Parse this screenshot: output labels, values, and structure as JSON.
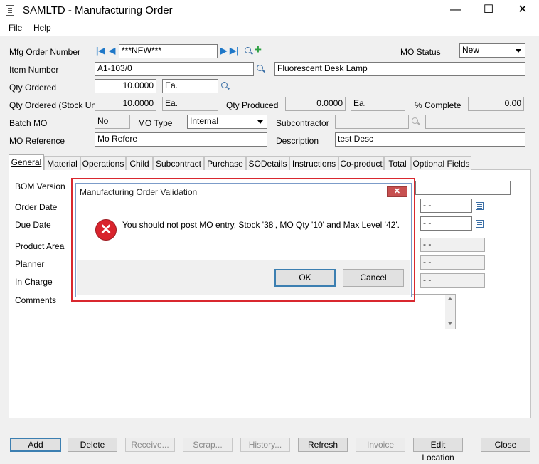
{
  "window": {
    "title": "SAMLTD - Manufacturing Order",
    "minimize": "—",
    "maximize": "☐",
    "close": "✕"
  },
  "menu": {
    "file": "File",
    "help": "Help"
  },
  "header": {
    "mfg_order_label": "Mfg Order Number",
    "mfg_order_value": "***NEW***",
    "mo_status_label": "MO Status",
    "mo_status_value": "New",
    "item_number_label": "Item Number",
    "item_number_value": "A1-103/0",
    "item_description": "Fluorescent Desk Lamp",
    "qty_ordered_label": "Qty Ordered",
    "qty_ordered_value": "10.0000",
    "qty_ordered_unit": "Ea.",
    "qty_ordered_stock_label": "Qty Ordered (Stock Unit)",
    "qty_ordered_stock_value": "10.0000",
    "qty_ordered_stock_unit": "Ea.",
    "qty_produced_label": "Qty Produced",
    "qty_produced_value": "0.0000",
    "qty_produced_unit": "Ea.",
    "pct_complete_label": "% Complete",
    "pct_complete_value": "0.00",
    "batch_mo_label": "Batch MO",
    "batch_mo_value": "No",
    "mo_type_label": "MO Type",
    "mo_type_value": "Internal",
    "subcontractor_label": "Subcontractor",
    "mo_reference_label": "MO Reference",
    "mo_reference_value": "Mo Refere",
    "description_label": "Description",
    "description_value": "test Desc"
  },
  "tabs": {
    "general": "General",
    "material": "Material",
    "operations": "Operations",
    "child": "Child",
    "subcontract": "Subcontract",
    "purchase": "Purchase",
    "sodetails": "SODetails",
    "instructions": "Instructions",
    "coproduct": "Co-product",
    "total": "Total",
    "optional_fields": "Optional Fields"
  },
  "general": {
    "bom_version": "BOM Version",
    "order_date": "Order Date",
    "order_date_value": "- -",
    "due_date": "Due Date",
    "due_date_value": "- -",
    "product_area": "Product Area",
    "product_area_value": "- -",
    "planner": "Planner",
    "planner_value": "- -",
    "in_charge": "In Charge",
    "in_charge_value": "- -",
    "comments": "Comments"
  },
  "buttons": {
    "add": "Add",
    "delete": "Delete",
    "receive": "Receive...",
    "scrap": "Scrap...",
    "history": "History...",
    "refresh": "Refresh",
    "invoice": "Invoice",
    "edit_location": "Edit Location",
    "close": "Close"
  },
  "dialog": {
    "title": "Manufacturing Order Validation",
    "close": "✕",
    "message": "You should not post MO entry, Stock '38', MO Qty '10' and Max Level '42'.",
    "icon": "error-icon",
    "ok": "OK",
    "cancel": "Cancel"
  },
  "colors": {
    "dialog_highlight": "#d9282f",
    "nav_blue": "#1f78c8",
    "error_red": "#d9242d"
  }
}
